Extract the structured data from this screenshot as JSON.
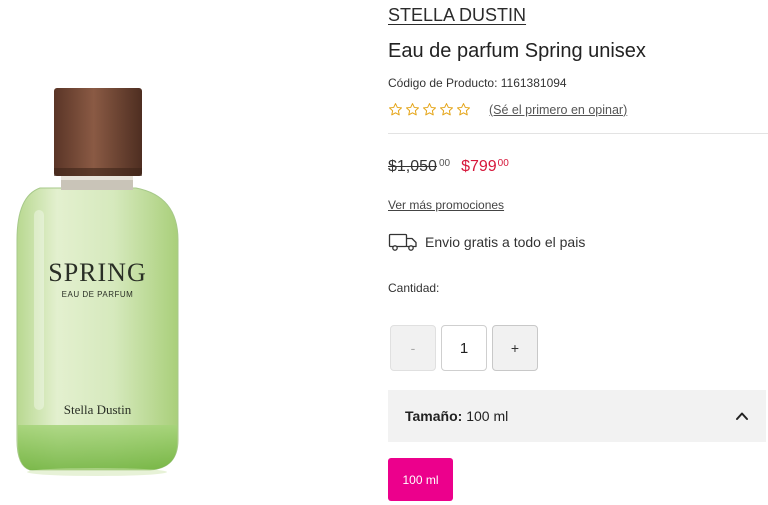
{
  "product": {
    "brand": "STELLA DUSTIN",
    "title": "Eau de parfum Spring unisex",
    "sku": "Código de Producto: 1161381094",
    "review_link": "(Sé el primero en opinar)",
    "rating_stars": 0,
    "bottle_name": "SPRING",
    "bottle_subtitle": "EAU DE PARFUM",
    "bottle_brand": "Stella Dustin"
  },
  "price": {
    "old_whole": "$1,050",
    "old_cents": "00",
    "new_whole": "$799",
    "new_cents": "00",
    "new_color": "#d6173b"
  },
  "promos_link": "Ver más promociones",
  "shipping": {
    "icon": "truck-icon",
    "text": "Envio gratis a todo el pais"
  },
  "quantity": {
    "label": "Cantidad:",
    "minus": "-",
    "value": "1",
    "plus": "+"
  },
  "size": {
    "label": "Tamaño:",
    "value": "100 ml",
    "expanded": true,
    "options": [
      "100 ml"
    ],
    "chip_color": "#ec008c"
  }
}
